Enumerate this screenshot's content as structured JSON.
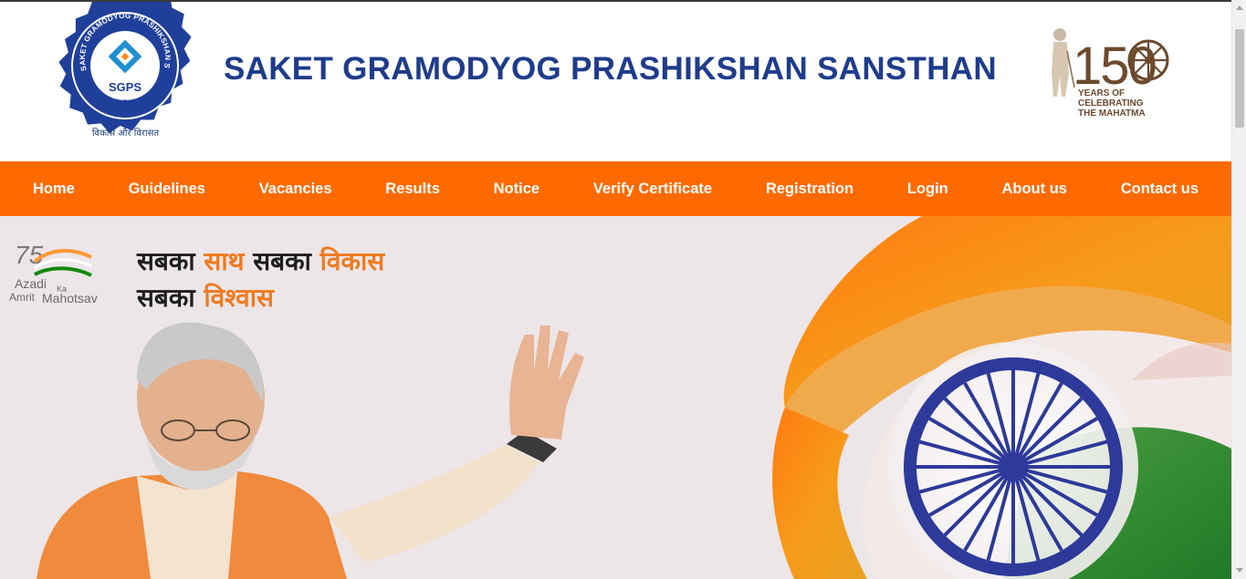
{
  "header": {
    "logo_ring_text": "SAKET GRAMODYOG PRASHIKSHAN SANSTHAN",
    "logo_abbr": "SGPS",
    "logo_tagline": "विकास और विरासत",
    "site_title": "SAKET GRAMODYOG PRASHIKSHAN SANSTHAN",
    "badge_number": "150",
    "badge_line1": "YEARS OF",
    "badge_line2": "CELEBRATING",
    "badge_line3": "THE MAHATMA"
  },
  "nav": {
    "items": [
      {
        "label": "Home"
      },
      {
        "label": "Guidelines"
      },
      {
        "label": "Vacancies"
      },
      {
        "label": "Results"
      },
      {
        "label": "Notice"
      },
      {
        "label": "Verify Certificate"
      },
      {
        "label": "Registration"
      },
      {
        "label": "Login"
      },
      {
        "label": "About us"
      },
      {
        "label": "Contact us"
      }
    ]
  },
  "hero": {
    "azadi_number": "75",
    "azadi_line1": "Azadi",
    "azadi_ka": "Ka",
    "azadi_line2": "Amrit",
    "azadi_line3": "Mahotsav",
    "slogan_line1_a": "सबका ",
    "slogan_line1_b": "साथ",
    "slogan_line1_c": " सबका ",
    "slogan_line1_d": "विकास",
    "slogan_line2_a": "सबका ",
    "slogan_line2_b": "विश्वास"
  },
  "colors": {
    "nav_bg": "#ff6a00",
    "title_blue": "#1f3c8c",
    "saffron": "#ff9933",
    "green": "#138808",
    "chakra_blue": "#2d3a9a"
  },
  "icons": {
    "logo": "sgps-seal-logo",
    "badge": "gandhi-150-years-badge",
    "azadi": "azadi-ka-amrit-mahotsav-logo",
    "chakra": "ashoka-chakra-icon"
  }
}
